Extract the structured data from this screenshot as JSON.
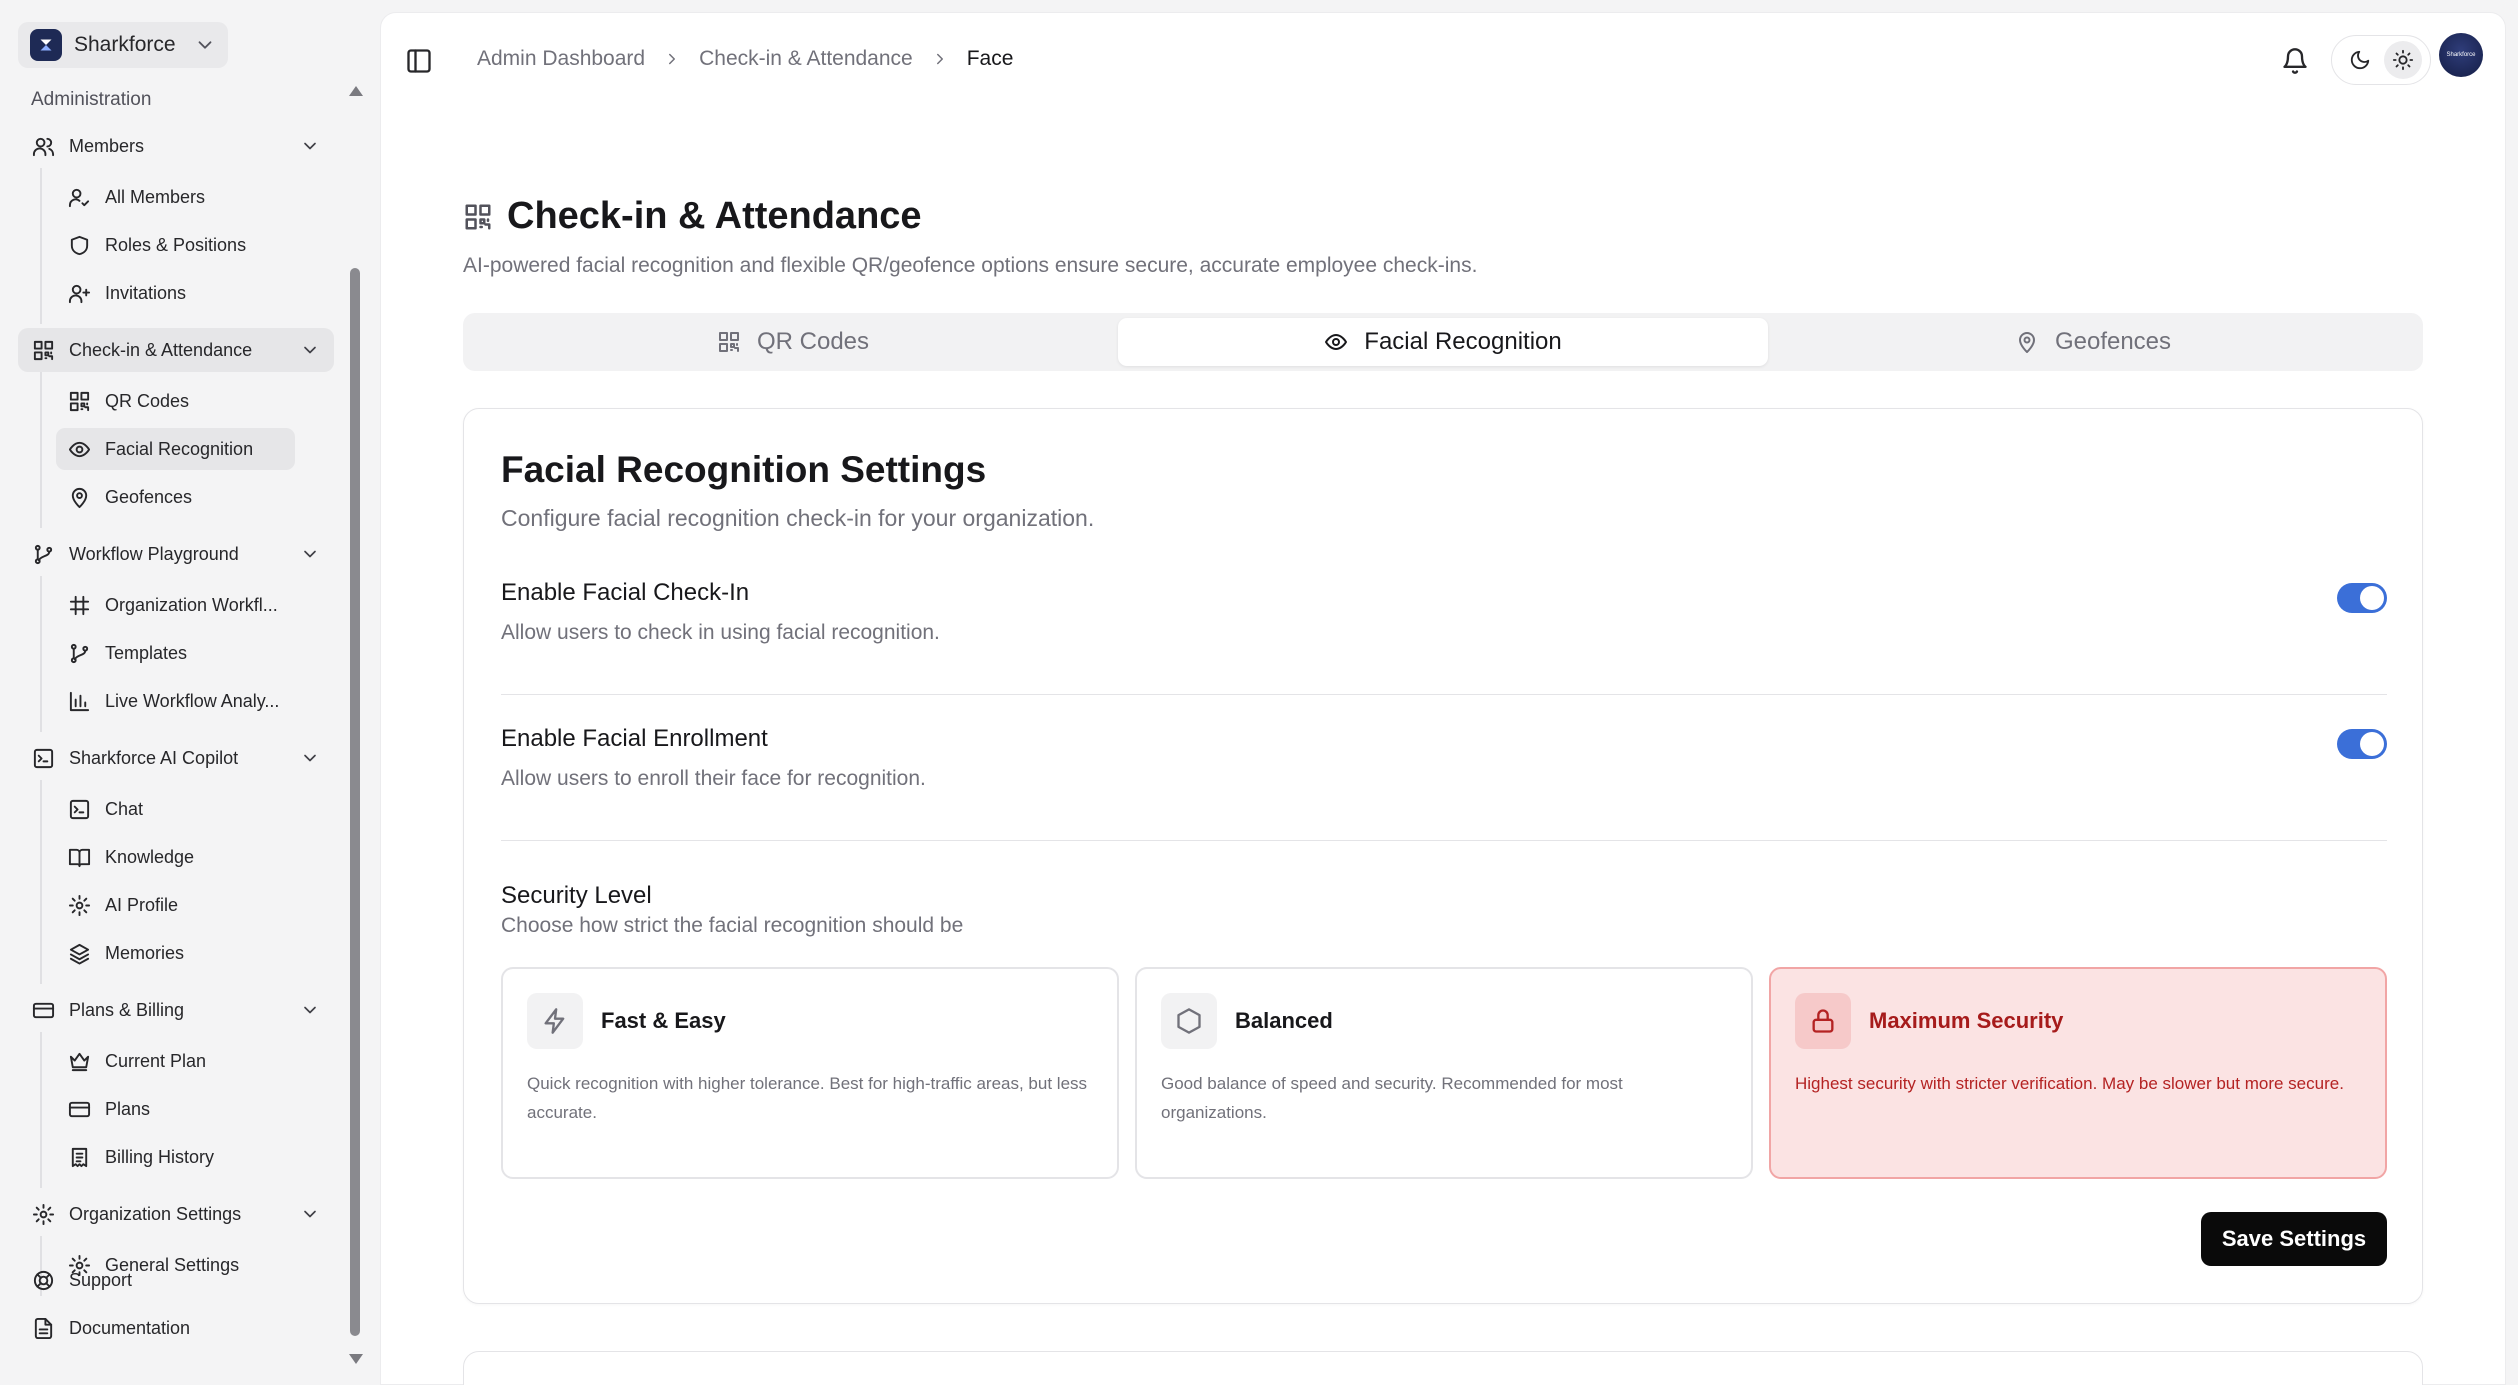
{
  "org": {
    "name": "Sharkforce"
  },
  "sidebar": {
    "section_label": "Administration",
    "groups": [
      {
        "label": "Members",
        "items": [
          {
            "label": "All Members"
          },
          {
            "label": "Roles & Positions"
          },
          {
            "label": "Invitations"
          }
        ]
      },
      {
        "label": "Check-in & Attendance",
        "items": [
          {
            "label": "QR Codes"
          },
          {
            "label": "Facial Recognition"
          },
          {
            "label": "Geofences"
          }
        ]
      },
      {
        "label": "Workflow Playground",
        "items": [
          {
            "label": "Organization Workfl..."
          },
          {
            "label": "Templates"
          },
          {
            "label": "Live Workflow Analy..."
          }
        ]
      },
      {
        "label": "Sharkforce AI Copilot",
        "items": [
          {
            "label": "Chat"
          },
          {
            "label": "Knowledge"
          },
          {
            "label": "AI Profile"
          },
          {
            "label": "Memories"
          }
        ]
      },
      {
        "label": "Plans & Billing",
        "items": [
          {
            "label": "Current Plan"
          },
          {
            "label": "Plans"
          },
          {
            "label": "Billing History"
          }
        ]
      },
      {
        "label": "Organization Settings",
        "items": [
          {
            "label": "General Settings"
          }
        ]
      }
    ],
    "bottom": [
      {
        "label": "Support"
      },
      {
        "label": "Documentation"
      }
    ]
  },
  "breadcrumb": [
    "Admin Dashboard",
    "Check-in & Attendance",
    "Face"
  ],
  "user": {
    "avatar_text": "Sharkforce"
  },
  "page": {
    "title": "Check-in & Attendance",
    "subtitle": "AI-powered facial recognition and flexible QR/geofence options ensure secure, accurate employee check-ins."
  },
  "tabs": [
    {
      "label": "QR Codes"
    },
    {
      "label": "Facial Recognition"
    },
    {
      "label": "Geofences"
    }
  ],
  "settings_card": {
    "title": "Facial Recognition Settings",
    "subtitle": "Configure facial recognition check-in for your organization.",
    "enable_checkin": {
      "title": "Enable Facial Check-In",
      "desc": "Allow users to check in using facial recognition.",
      "on": true
    },
    "enable_enrollment": {
      "title": "Enable Facial Enrollment",
      "desc": "Allow users to enroll their face for recognition.",
      "on": true
    },
    "security": {
      "title": "Security Level",
      "desc": "Choose how strict the facial recognition should be",
      "options": [
        {
          "title": "Fast & Easy",
          "desc": "Quick recognition with higher tolerance. Best for high-traffic areas, but less accurate.",
          "icon": "bolt-icon"
        },
        {
          "title": "Balanced",
          "desc": "Good balance of speed and security. Recommended for most organizations.",
          "icon": "hexagon-icon"
        },
        {
          "title": "Maximum Security",
          "desc": "Highest security with stricter verification. May be slower but more secure.",
          "icon": "lock-icon",
          "selected": true
        }
      ]
    },
    "save_label": "Save Settings"
  },
  "colors": {
    "accent": "#3b6fd8",
    "danger": "#b42323",
    "danger_bg": "#fbe3e3"
  }
}
